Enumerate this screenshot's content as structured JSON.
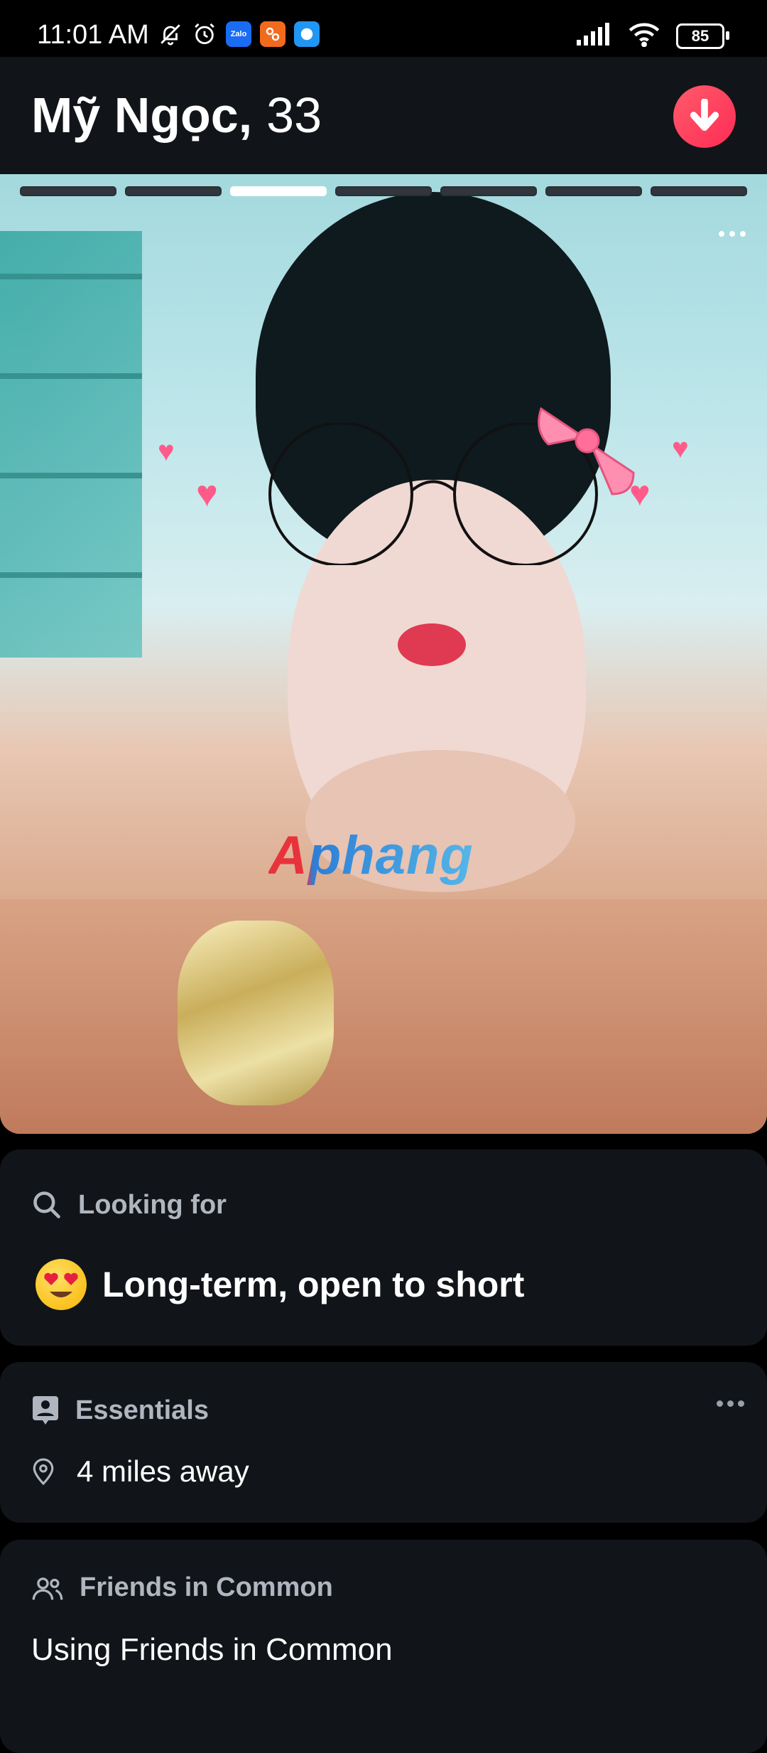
{
  "status_bar": {
    "time": "11:01 AM",
    "battery": "85",
    "zalo_label": "Zalo"
  },
  "profile": {
    "name": "Mỹ Ngọc,",
    "age": "33"
  },
  "photo": {
    "page": 3,
    "total_pages": 7,
    "watermark": "Aphang"
  },
  "looking_for": {
    "heading": "Looking for",
    "value": "Long-term, open to short"
  },
  "essentials": {
    "heading": "Essentials",
    "distance": "4 miles away"
  },
  "friends": {
    "heading": "Friends in Common",
    "text": "Using Friends in Common"
  },
  "colors": {
    "accent": "#fe3c5b",
    "card_bg": "#111418"
  }
}
